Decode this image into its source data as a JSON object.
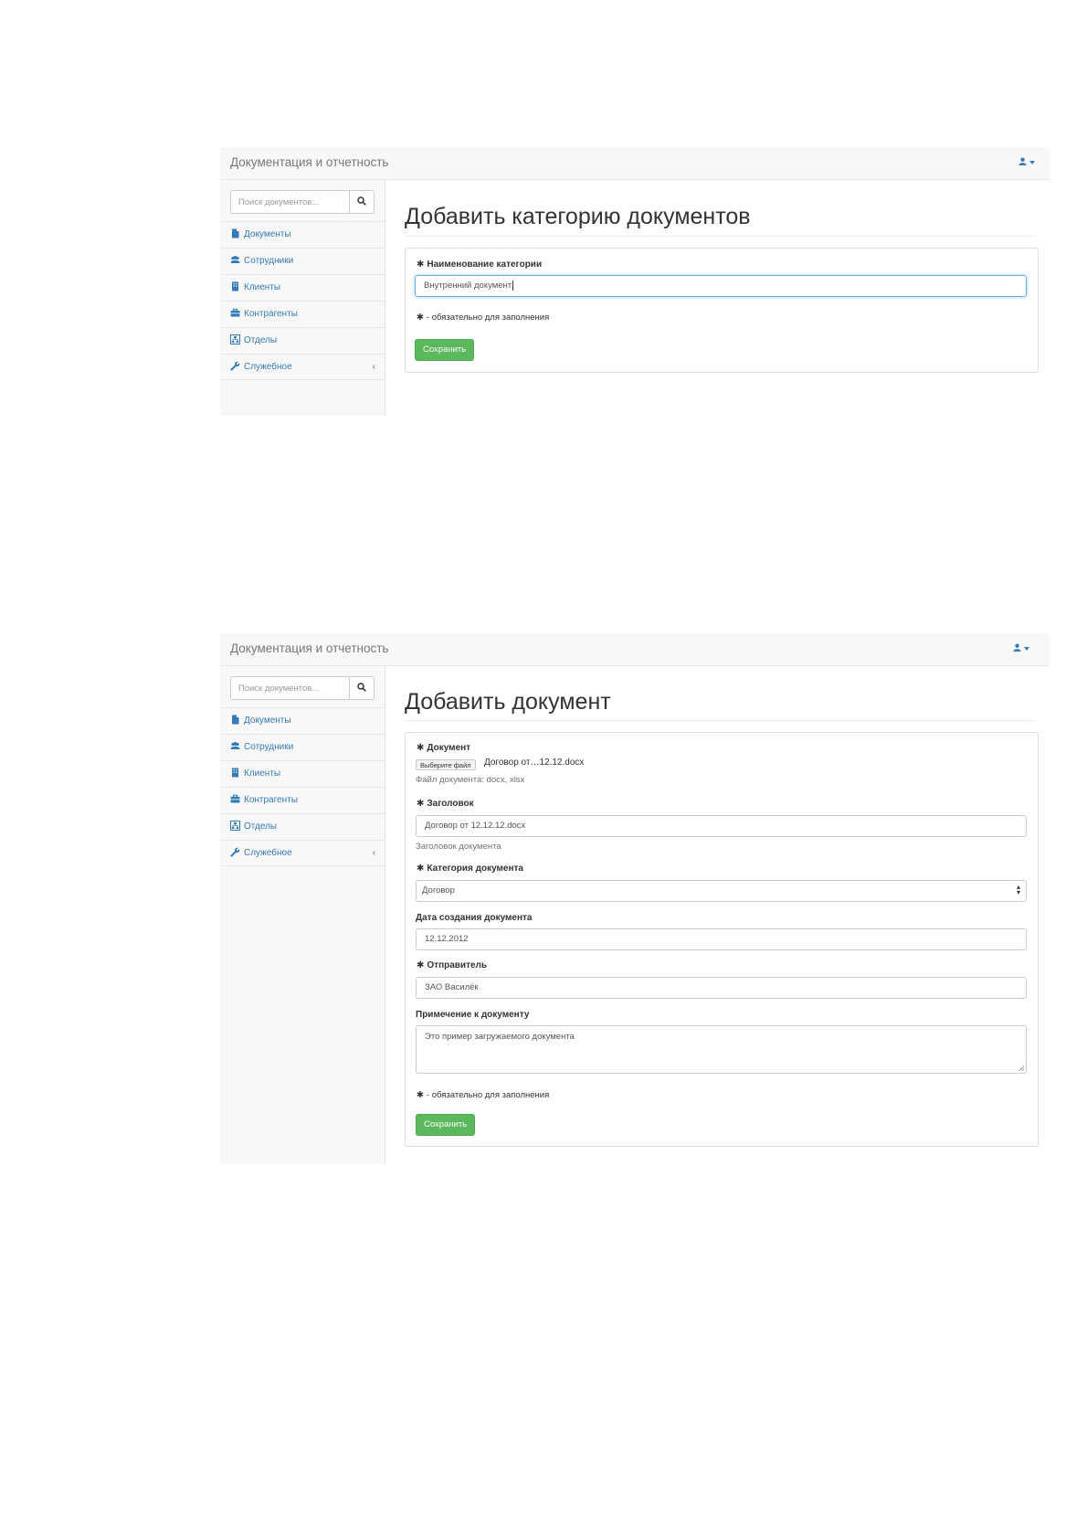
{
  "screens": [
    {
      "brand": "Документация и отчетность",
      "search": {
        "placeholder": "Поиск документов..."
      },
      "sidebar": [
        {
          "label": "Документы",
          "icon": "file-icon"
        },
        {
          "label": "Сотрудники",
          "icon": "users-icon"
        },
        {
          "label": "Клиенты",
          "icon": "building-icon"
        },
        {
          "label": "Контрагенты",
          "icon": "briefcase-icon"
        },
        {
          "label": "Отделы",
          "icon": "sitemap-icon"
        },
        {
          "label": "Служебное",
          "icon": "wrench-icon",
          "chevron": "‹"
        }
      ],
      "title": "Добавить категорию документов",
      "form": {
        "category_name_label": "Наименование категории",
        "category_name_value": "Внутренний документ",
        "required_note": "- обязательно для заполнения",
        "save": "Сохранить"
      }
    },
    {
      "brand": "Документация и отчетность",
      "search": {
        "placeholder": "Поиск документов..."
      },
      "sidebar": [
        {
          "label": "Документы",
          "icon": "file-icon"
        },
        {
          "label": "Сотрудники",
          "icon": "users-icon"
        },
        {
          "label": "Клиенты",
          "icon": "building-icon"
        },
        {
          "label": "Контрагенты",
          "icon": "briefcase-icon"
        },
        {
          "label": "Отделы",
          "icon": "sitemap-icon"
        },
        {
          "label": "Служебное",
          "icon": "wrench-icon",
          "chevron": "‹"
        }
      ],
      "title": "Добавить документ",
      "form": {
        "document_label": "Документ",
        "file_button": "Выберите файл",
        "file_name": "Договор от…12.12.docx",
        "file_help": "Файл документа: docx, xlsx",
        "heading_label": "Заголовок",
        "heading_value": "Договор от 12.12.12.docx",
        "heading_help": "Заголовок документа",
        "category_label": "Категория документа",
        "category_value": "Договор",
        "date_label": "Дата создания документа",
        "date_value": "12.12.2012",
        "sender_label": "Отправитель",
        "sender_value": "ЗАО Василёк",
        "note_label": "Примечение к документу",
        "note_value": "Это пример загружаемого документа",
        "required_note": "- обязательно для заполнения",
        "save": "Сохранить"
      }
    }
  ],
  "colors": {
    "link": "#337ab7",
    "success": "#5cb85c",
    "navbar": "#f8f8f8"
  }
}
